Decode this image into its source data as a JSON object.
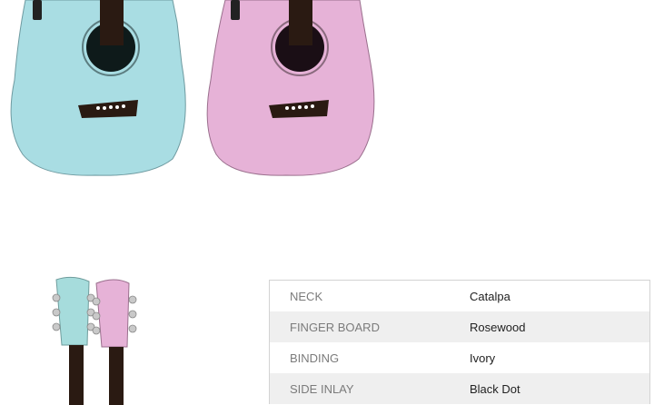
{
  "product_images": {
    "guitar_colors": [
      "#a9dde3",
      "#e6b2d7"
    ],
    "headstock_colors": [
      "#a6dcdc",
      "#e6b2d7"
    ]
  },
  "specs": [
    {
      "label": "NECK",
      "value": "Catalpa"
    },
    {
      "label": "FINGER BOARD",
      "value": "Rosewood"
    },
    {
      "label": "BINDING",
      "value": "Ivory"
    },
    {
      "label": "SIDE INLAY",
      "value": "Black Dot"
    }
  ]
}
